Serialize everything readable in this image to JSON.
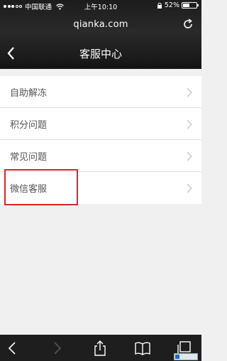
{
  "status_bar": {
    "carrier": "中国联通",
    "time": "上午10:10",
    "battery_percent": "52%",
    "battery_level": 0.52
  },
  "browser": {
    "url": "qianka.com",
    "reload_icon": "reload-icon"
  },
  "header": {
    "title": "客服中心",
    "back_icon": "chevron-left-icon"
  },
  "menu": {
    "items": [
      {
        "label": "自助解冻"
      },
      {
        "label": "积分问题"
      },
      {
        "label": "常见问题"
      },
      {
        "label": "微信客服"
      }
    ],
    "highlighted_item": "微信客服",
    "highlight_color": "#d8262a"
  },
  "toolbar": {
    "buttons": [
      "back-icon",
      "forward-icon",
      "share-icon",
      "bookmarks-icon",
      "tabs-icon"
    ]
  },
  "colors": {
    "header_bg": "#1c1c1c",
    "page_bg": "#f0f0f0",
    "toolbar_bg": "#1e1e1e"
  }
}
